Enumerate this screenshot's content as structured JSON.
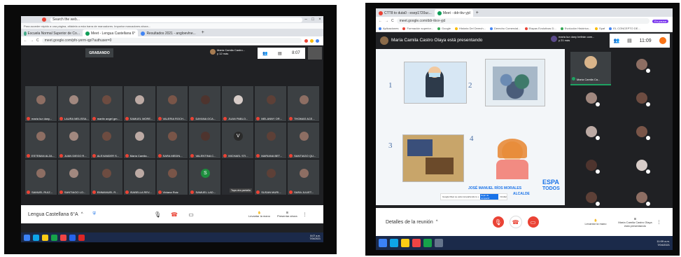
{
  "left": {
    "tabs": [
      "Escuela Normal Superior de Co...",
      "Meet - Lengua Castellana 6°",
      "Resultados 2021 - angloevlne..."
    ],
    "search_text": "Search the web...",
    "bookmark_hint": "Para acceder rápido a una página, añádela a esta barra de marcadores. Importar marcadores ahora...",
    "url": "meet.google.com/pfo-yerm-qpi?authuser=0",
    "recording_label": "GRABANDO",
    "presenter": "María Camila Castro...",
    "presenter_sub": "y 12 más",
    "time": "8:07",
    "participants": [
      "maria luz dany...",
      "LAURA MELISSA...",
      "martin angel gm...",
      "SAMUEL MORE...",
      "VALERIA ROCH...",
      "DAYANA OCA...",
      "JUAN PABLO...",
      "MELANNY OR...",
      "THOMAS ACE...",
      "ESTEBAN ALZA...",
      "JUAN DIEGO R...",
      "ALEXANDER S...",
      "María Camila...",
      "SARA MEDIN...",
      "VALENTINA C...",
      "MICHAEL STI...",
      "MARIANA BET...",
      "SANTIAGO QU...",
      "SAMUEL RUIZ...",
      "SANTIAGO LO...",
      "EMMANUEL R...",
      "ISABELLA REV...",
      "Viviana Ruiz",
      "SAMUEL LAD...",
      "",
      "SUSAN MURI...",
      "SARA JULIET..."
    ],
    "tooltip": "Tapa otra pantalla",
    "meeting_name": "Lengua Castellana 6°A",
    "taskbar_time": "8:07 a.m.",
    "taskbar_date": "7/04/2021"
  },
  "right": {
    "tabs": [
      "CTT8 to duta0 - esep1720uc...",
      "Meet - ddr-tkv-yjd",
      ""
    ],
    "url": "meet.google.com/ddr-tkvv-yjd",
    "bookmarks": [
      "Aplicaciones",
      "Formación superior...",
      "Google",
      "Historia Del Derech...",
      "Derecho Comercial...",
      "Etapas Evolutivas D...",
      "Evolución Histórica...",
      "Spaf",
      "EL CONCEPTO DE..."
    ],
    "profile": "En pausa",
    "presenting_title": "María Camila Castro Olaya está presentando",
    "people_title": "maria luz dany beltrán cam...",
    "people_sub": "y 21 más",
    "time": "11:09",
    "slide_numbers": [
      "1",
      "2",
      "3",
      "4"
    ],
    "pinned_name": "María Camila Ca...",
    "logo_top": "ESPA",
    "logo_bottom": "TODOS",
    "mayor_name": "JOSÉ MANUEL RÍOS MORALES",
    "mayor_title": "ALCALDE",
    "share_notice": "Google Meet se está compartiendo tu pantalla.",
    "share_stop": "Dejar de compartir",
    "share_hide": "Ocultar",
    "meeting_details": "Detalles de la reunión",
    "raise_hand": "Levantar la mano",
    "presenter_status": "María Camila Castro Olaya está presentando",
    "taskbar_time": "11:09 a.m.",
    "taskbar_date": "7/04/2021"
  },
  "left_bottom": {
    "raise_hand": "Levantar la mano",
    "present_now": "Presentar ahora"
  },
  "colors": {
    "meet_bg": "#202124",
    "red": "#ea4335",
    "blue": "#1a73e8"
  }
}
